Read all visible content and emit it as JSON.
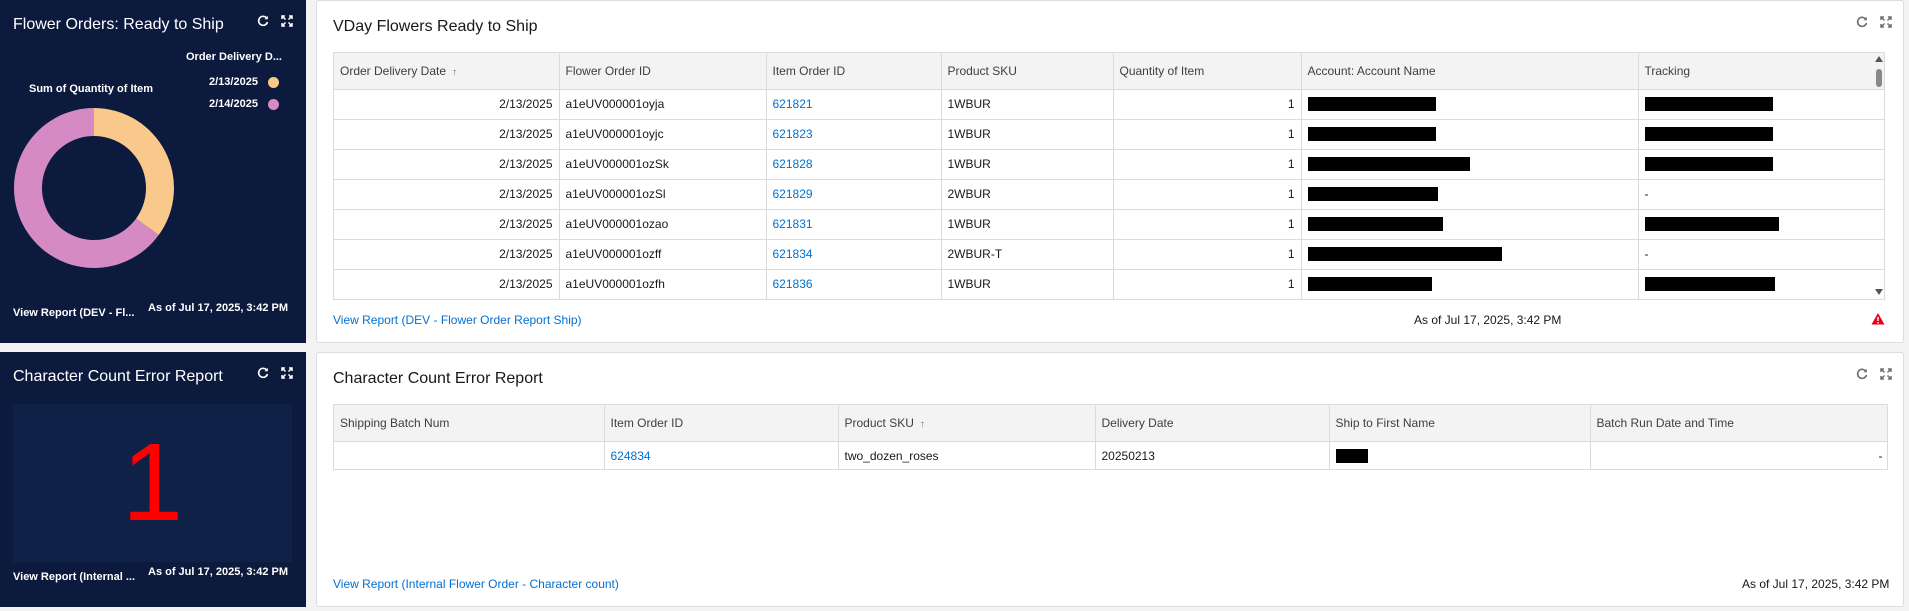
{
  "tile1": {
    "title": "Flower Orders: Ready to Ship",
    "legend_title": "Order Delivery D...",
    "chart_label": "Sum of Quantity of Item",
    "footer_link": "View Report (DEV - Fl...",
    "footer_asof": "As of Jul 17, 2025, 3:42 PM",
    "icons": [
      "refresh-icon",
      "expand-icon"
    ]
  },
  "chart_data": {
    "type": "pie",
    "title": "",
    "categories": [
      "2/13/2025",
      "2/14/2025"
    ],
    "values": [
      35,
      65
    ],
    "colors": [
      "#f9c98c",
      "#d58ac4"
    ],
    "legend_position": "top-right"
  },
  "tile2": {
    "title": "Character Count Error Report",
    "metric": "1",
    "metric_color": "#ff0000",
    "footer_link": "View Report (Internal ...",
    "footer_asof": "As of Jul 17, 2025, 3:42 PM"
  },
  "panel1": {
    "title": "VDay Flowers Ready to Ship",
    "columns": [
      "Order Delivery Date",
      "Flower Order ID",
      "Item Order ID",
      "Product SKU",
      "Quantity of Item",
      "Account: Account Name",
      "Tracking"
    ],
    "rows": [
      {
        "date": "2/13/2025",
        "flower_id": "a1eUV000001oyja",
        "item_id": "621821",
        "sku": "1WBUR",
        "qty": "1",
        "tracking": ""
      },
      {
        "date": "2/13/2025",
        "flower_id": "a1eUV000001oyjc",
        "item_id": "621823",
        "sku": "1WBUR",
        "qty": "1",
        "tracking": ""
      },
      {
        "date": "2/13/2025",
        "flower_id": "a1eUV000001ozSk",
        "item_id": "621828",
        "sku": "1WBUR",
        "qty": "1",
        "tracking": ""
      },
      {
        "date": "2/13/2025",
        "flower_id": "a1eUV000001ozSl",
        "item_id": "621829",
        "sku": "2WBUR",
        "qty": "1",
        "tracking": "-"
      },
      {
        "date": "2/13/2025",
        "flower_id": "a1eUV000001ozao",
        "item_id": "621831",
        "sku": "1WBUR",
        "qty": "1",
        "tracking": ""
      },
      {
        "date": "2/13/2025",
        "flower_id": "a1eUV000001ozff",
        "item_id": "621834",
        "sku": "2WBUR-T",
        "qty": "1",
        "tracking": "-"
      },
      {
        "date": "2/13/2025",
        "flower_id": "a1eUV000001ozfh",
        "item_id": "621836",
        "sku": "1WBUR",
        "qty": "1",
        "tracking": ""
      }
    ],
    "footer_link": "View Report (DEV - Flower Order Report Ship)",
    "footer_asof": "As of Jul 17, 2025, 3:42 PM",
    "warning_color": "#ea001e"
  },
  "panel2": {
    "title": "Character Count Error Report",
    "columns": [
      "Shipping Batch Num",
      "Item Order ID",
      "Product SKU",
      "Delivery Date",
      "Ship to First Name",
      "Batch Run Date and Time"
    ],
    "rows": [
      {
        "batch": "",
        "item_id": "624834",
        "sku": "two_dozen_roses",
        "delivery": "20250213",
        "batch_time": "-"
      }
    ],
    "footer_link": "View Report (Internal Flower Order - Character count)",
    "footer_asof": "As of Jul 17, 2025, 3:42 PM"
  }
}
